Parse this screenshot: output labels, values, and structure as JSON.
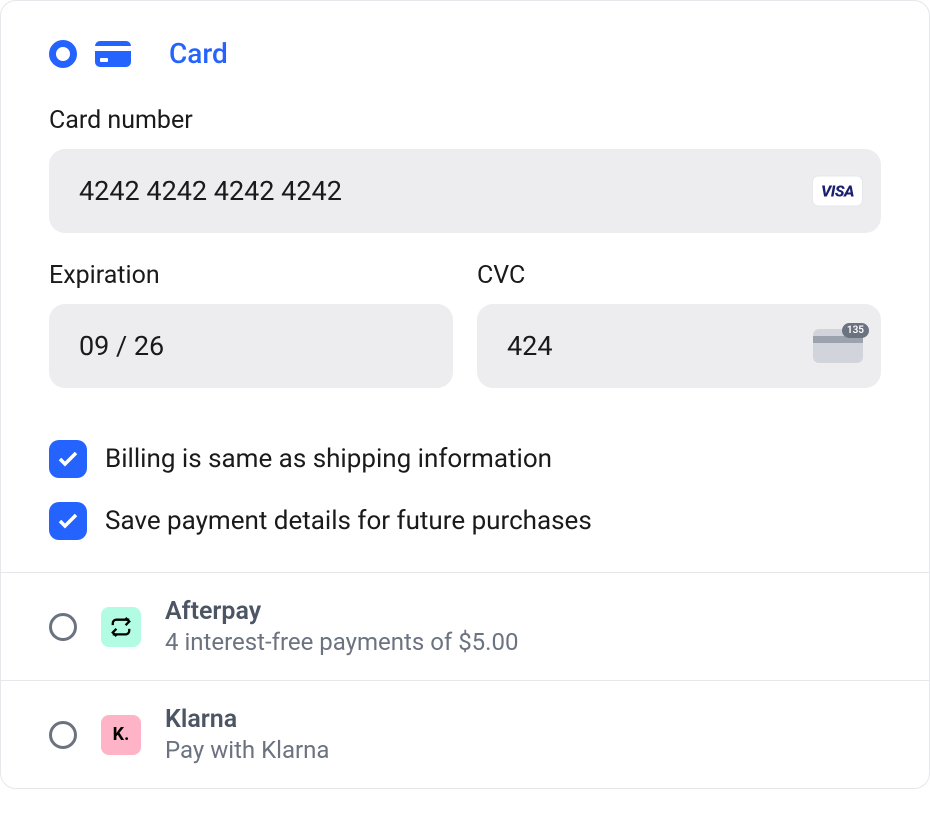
{
  "payment": {
    "card": {
      "label": "Card",
      "number_label": "Card number",
      "number_value": "4242 4242 4242 4242",
      "brand": "VISA",
      "expiration_label": "Expiration",
      "expiration_value": "09 / 26",
      "cvc_label": "CVC",
      "cvc_value": "424",
      "cvc_hint": "135"
    },
    "checkboxes": {
      "billing_same": "Billing is same as shipping information",
      "save_payment": "Save payment details for future purchases"
    },
    "options": {
      "afterpay": {
        "name": "Afterpay",
        "desc": "4 interest-free payments of $5.00"
      },
      "klarna": {
        "name": "Klarna",
        "desc": "Pay with Klarna",
        "icon_text": "K."
      }
    }
  }
}
